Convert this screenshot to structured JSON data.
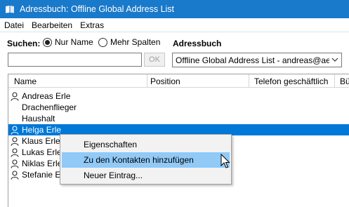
{
  "window": {
    "title": "Adressbuch: Offline Global Address List"
  },
  "menu": {
    "items": [
      "Datei",
      "Bearbeiten",
      "Extras"
    ]
  },
  "search": {
    "label": "Suchen:",
    "options": [
      "Nur Name",
      "Mehr Spalten"
    ],
    "selected": "Nur Name",
    "value": "",
    "ok_label": "OK"
  },
  "addressbook": {
    "label": "Adressbuch",
    "selected": "Offline Global Address List - andreas@aerl"
  },
  "columns": [
    "Name",
    "Position",
    "Telefon geschäftlich",
    "Bü"
  ],
  "rows": [
    {
      "name": "Andreas Erle",
      "icon": "person-icon"
    },
    {
      "name": "Drachenflieger",
      "icon": ""
    },
    {
      "name": "Haushalt",
      "icon": ""
    },
    {
      "name": "Helga Erle",
      "icon": "person-icon",
      "selected": true
    },
    {
      "name": "Klaus Erle",
      "icon": "person-icon"
    },
    {
      "name": "Lukas Erle",
      "icon": "person-icon"
    },
    {
      "name": "Niklas Erle",
      "icon": "person-icon"
    },
    {
      "name": "Stefanie Erle",
      "icon": "person-icon"
    }
  ],
  "context_menu": {
    "items": [
      "Eigenschaften",
      "Zu den Kontakten hinzufügen",
      "Neuer Eintrag..."
    ],
    "highlighted": "Zu den Kontakten hinzufügen"
  },
  "colors": {
    "titlebar": "#1979ca",
    "selection": "#0078d7",
    "menu_hover": "#91c9f7"
  }
}
